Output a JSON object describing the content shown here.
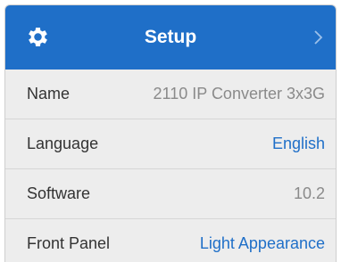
{
  "header": {
    "title": "Setup",
    "icon": "gear-icon",
    "chevron_icon": "chevron-right-icon",
    "bg": "#1f6fc8"
  },
  "rows": [
    {
      "label": "Name",
      "value": "2110 IP Converter 3x3G"
    },
    {
      "label": "Language",
      "value": "English"
    },
    {
      "label": "Software",
      "value": "10.2"
    },
    {
      "label": "Front Panel",
      "value": "Light Appearance"
    }
  ],
  "colors": {
    "link": "#1f6fc8",
    "value": "#8a8a8a",
    "label": "#333333",
    "row_bg": "#ededed"
  }
}
